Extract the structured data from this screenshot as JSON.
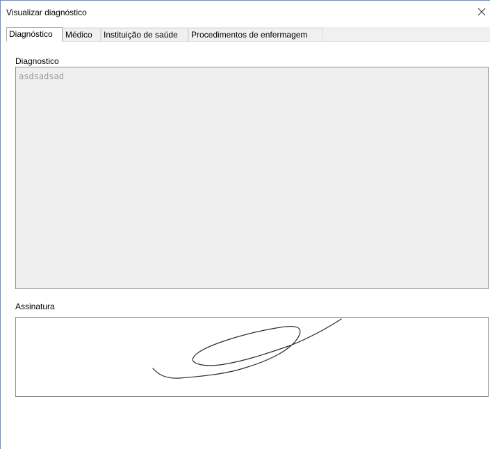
{
  "window": {
    "title": "Visualizar diagnóstico",
    "close_icon": "close-icon"
  },
  "tabs": [
    {
      "label": "Diagnóstico",
      "active": true
    },
    {
      "label": "Médico",
      "active": false
    },
    {
      "label": "Instituição de saúde",
      "active": false
    },
    {
      "label": "Procedimentos de enfermagem",
      "active": false
    }
  ],
  "diagnostico": {
    "label": "Diagnostico",
    "value": "asdsadsad"
  },
  "assinatura": {
    "label": "Assinatura"
  },
  "colors": {
    "window_border": "#5b8fd8",
    "field_background": "#efefef",
    "field_text": "#9a9a9a",
    "field_border": "#8c8c8c"
  }
}
